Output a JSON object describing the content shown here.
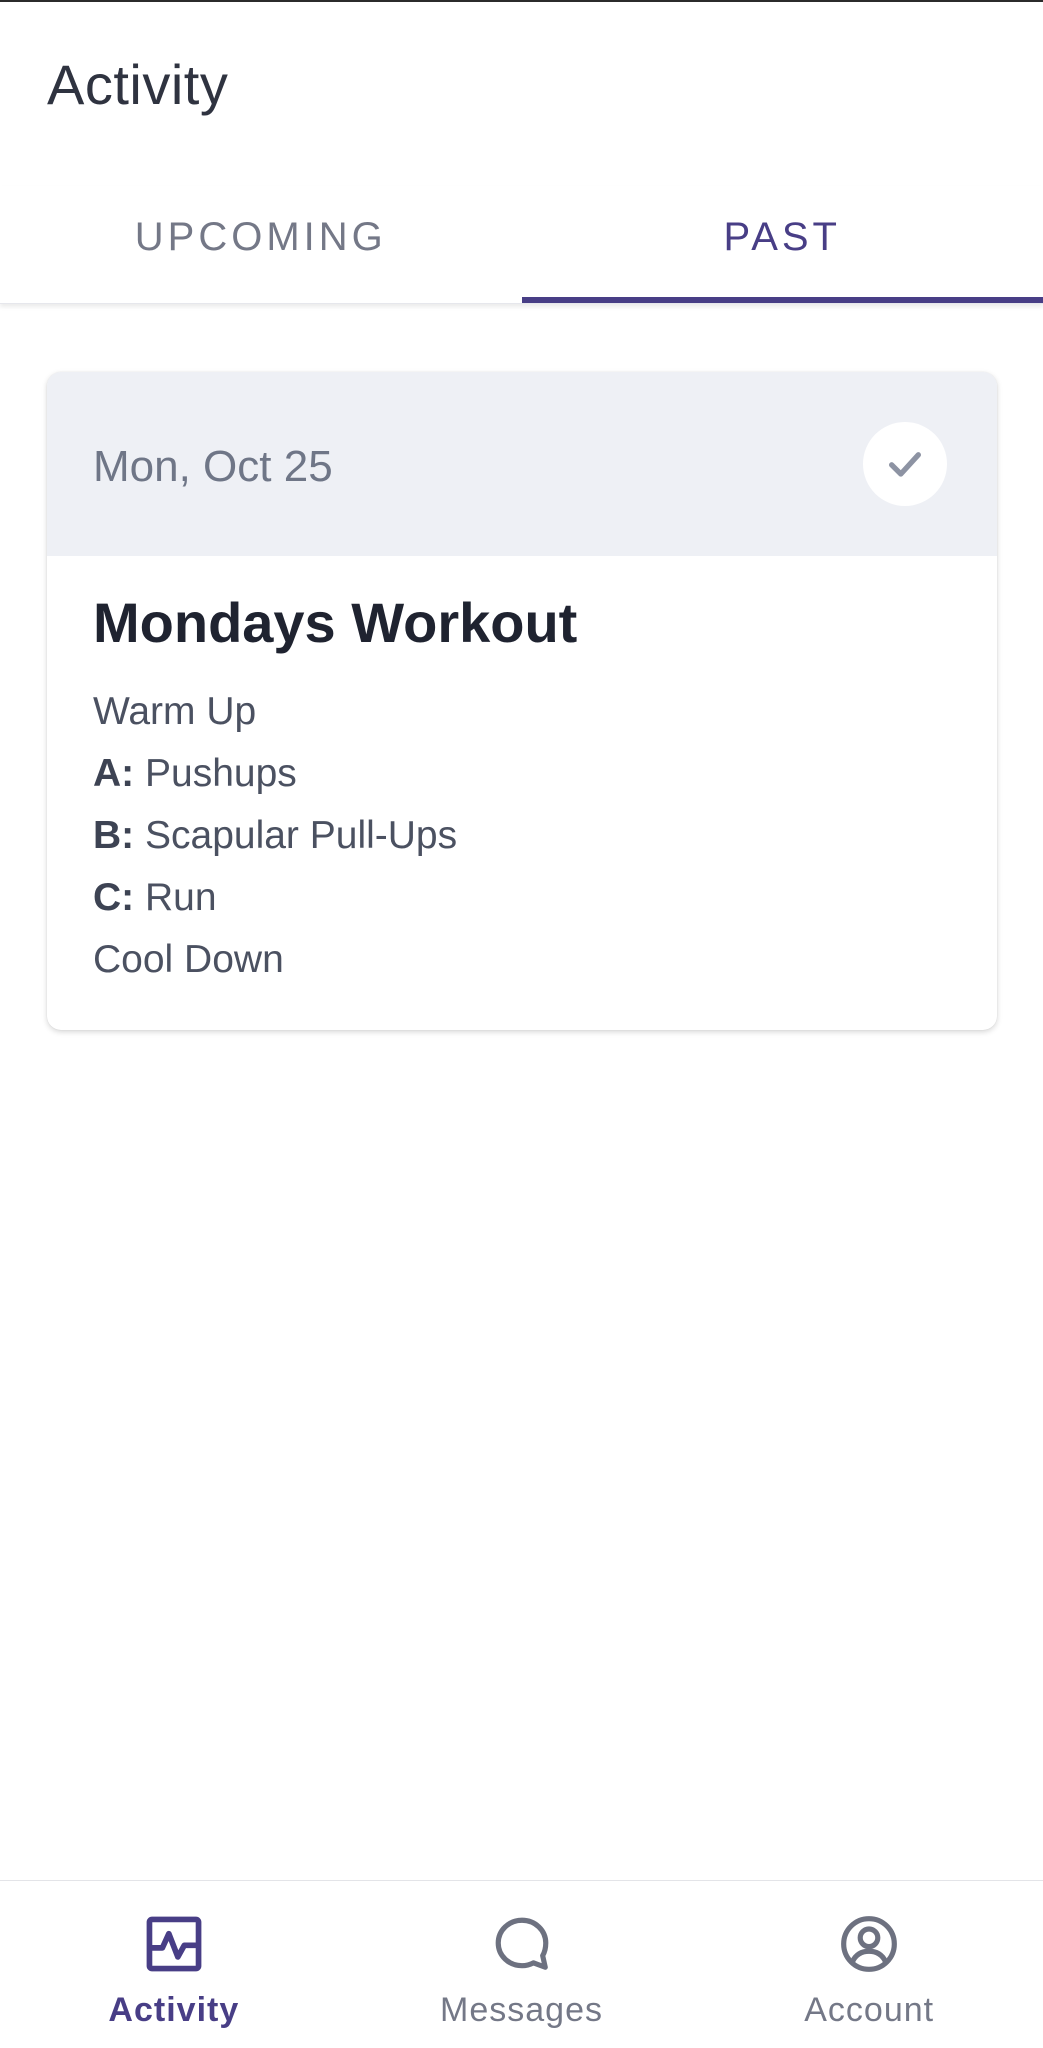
{
  "header": {
    "title": "Activity"
  },
  "tabs": [
    {
      "label": "UPCOMING",
      "active": false
    },
    {
      "label": "PAST",
      "active": true
    }
  ],
  "card": {
    "date": "Mon, Oct 25",
    "completed": true,
    "title": "Mondays Workout",
    "items": [
      {
        "letter": "",
        "name": "Warm Up"
      },
      {
        "letter": "A:",
        "name": " Pushups"
      },
      {
        "letter": "B:",
        "name": " Scapular Pull-Ups"
      },
      {
        "letter": "C:",
        "name": " Run"
      },
      {
        "letter": "",
        "name": "Cool Down"
      }
    ]
  },
  "bottom_nav": [
    {
      "label": "Activity",
      "icon": "activity-chart-icon",
      "active": true
    },
    {
      "label": "Messages",
      "icon": "chat-bubble-icon",
      "active": false
    },
    {
      "label": "Account",
      "icon": "user-circle-icon",
      "active": false
    }
  ],
  "colors": {
    "accent": "#483e86",
    "muted_text": "#747887",
    "card_header_bg": "#eef0f5",
    "check": "#8d93a3"
  }
}
